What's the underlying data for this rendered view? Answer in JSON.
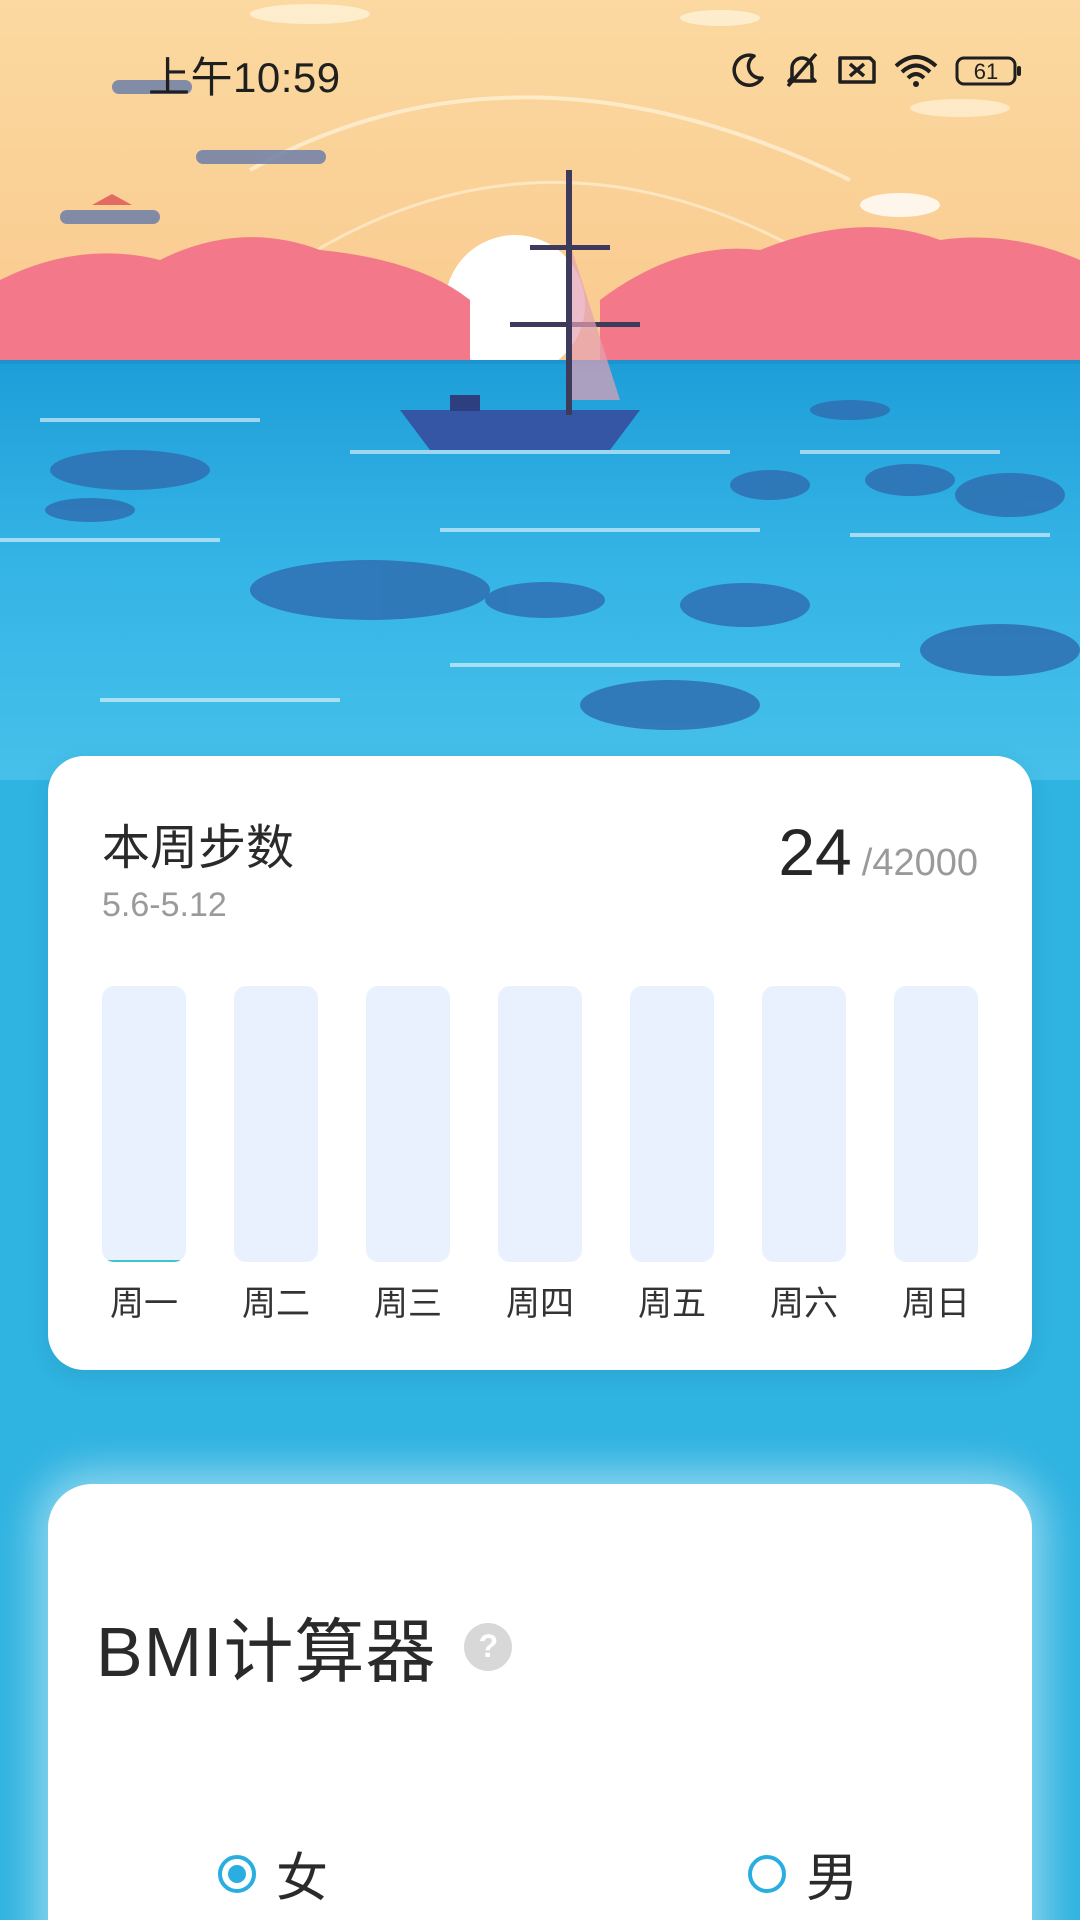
{
  "status_bar": {
    "time": "上午10:59",
    "battery": "61",
    "icons": [
      "moon-icon",
      "bell-muted-icon",
      "sim-disabled-icon",
      "wifi-icon",
      "battery-icon"
    ]
  },
  "colors": {
    "accent": "#2aaee0",
    "background": "#2fb3e1",
    "bar_empty": "#eaf1fe",
    "bar_fill": "#3cc6c8"
  },
  "steps_card": {
    "title": "本周步数",
    "date_range": "5.6-5.12",
    "current_steps": "24",
    "goal": "/42000",
    "days": [
      {
        "label": "周一",
        "fill": 0.005
      },
      {
        "label": "周二",
        "fill": 0
      },
      {
        "label": "周三",
        "fill": 0
      },
      {
        "label": "周四",
        "fill": 0
      },
      {
        "label": "周五",
        "fill": 0
      },
      {
        "label": "周六",
        "fill": 0
      },
      {
        "label": "周日",
        "fill": 0
      }
    ]
  },
  "bmi_card": {
    "title": "BMI计算器",
    "help_symbol": "?",
    "gender_options": [
      {
        "label": "女",
        "selected": true
      },
      {
        "label": "男",
        "selected": false
      }
    ]
  }
}
